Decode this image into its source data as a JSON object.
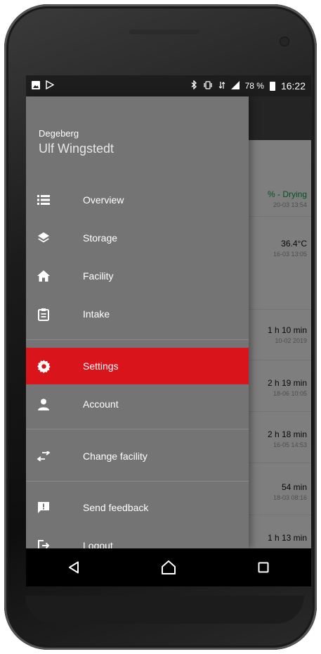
{
  "status_bar": {
    "battery_percent": "78 %",
    "time": "16:22",
    "icons": [
      "image-icon",
      "play-store-icon",
      "bluetooth-icon",
      "vibrate-icon",
      "data-icon",
      "signal-icon",
      "battery-icon"
    ]
  },
  "drawer": {
    "facility_name": "Degeberg",
    "user_name": "Ulf Wingstedt",
    "items": [
      {
        "label": "Overview",
        "icon": "list-icon"
      },
      {
        "label": "Storage",
        "icon": "layers-icon"
      },
      {
        "label": "Facility",
        "icon": "home-icon"
      },
      {
        "label": "Intake",
        "icon": "clipboard-icon"
      },
      {
        "label": "Settings",
        "icon": "gear-icon",
        "active": true
      },
      {
        "label": "Account",
        "icon": "person-icon"
      },
      {
        "label": "Change facility",
        "icon": "swap-icon"
      },
      {
        "label": "Send feedback",
        "icon": "feedback-icon"
      },
      {
        "label": "Logout",
        "icon": "logout-icon"
      }
    ],
    "active_color": "#d9141b"
  },
  "background_list": {
    "rows": [
      {
        "main": "% - Drying",
        "sub": "20-03 13:54",
        "accent": "#0c8f3c"
      },
      {
        "main": "36.4°C",
        "sub": "16-03 13:05"
      },
      {
        "main": "1 h 10 min",
        "sub": "10-02 2019"
      },
      {
        "main": "2 h 19 min",
        "sub": "18-06 10:05"
      },
      {
        "main": "2 h 18 min",
        "sub": "16-05 14:53"
      },
      {
        "main": "54 min",
        "sub": "18-03 08:16"
      },
      {
        "main": "1 h 13 min",
        "sub": ""
      }
    ]
  },
  "nav_bar": {
    "buttons": [
      "back-icon",
      "home-icon",
      "recents-icon"
    ]
  }
}
